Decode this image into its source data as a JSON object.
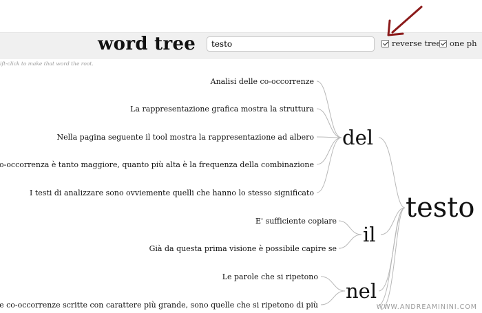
{
  "header": {
    "title": "word tree",
    "search_value": "testo",
    "options": {
      "reverse_tree": {
        "label": "reverse tree",
        "checked": true
      },
      "one_phrase": {
        "label": "one ph",
        "checked": true
      }
    },
    "hint": "ift-click to make that word the root."
  },
  "tree": {
    "root": "testo",
    "branches": [
      {
        "word": "del",
        "phrases": [
          "Analisi delle co-occorrenze",
          "La rappresentazione grafica mostra la struttura",
          "Nella pagina seguente il tool mostra la rappresentazione ad albero",
          "co-occorrenza è tanto maggiore, quanto più alta è la frequenza della combinazione",
          "I testi di analizzare sono ovviemente quelli che hanno lo stesso significato"
        ]
      },
      {
        "word": "il",
        "phrases": [
          "E' sufficiente copiare",
          "Già da questa prima visione è possibile capire se"
        ]
      },
      {
        "word": "nel",
        "phrases": [
          "Le parole che si ripetono",
          "ce, le co-occorrenze scritte con carattere più grande, sono quelle che si ripetono di più"
        ]
      }
    ]
  },
  "watermark": "WWW.ANDREAMININI.COM",
  "annotation": {
    "arrow_color": "#8b1a1a"
  },
  "colors": {
    "toolbar_bg": "#f0f0f0",
    "connector": "#b8b8b8",
    "text": "#111111"
  }
}
